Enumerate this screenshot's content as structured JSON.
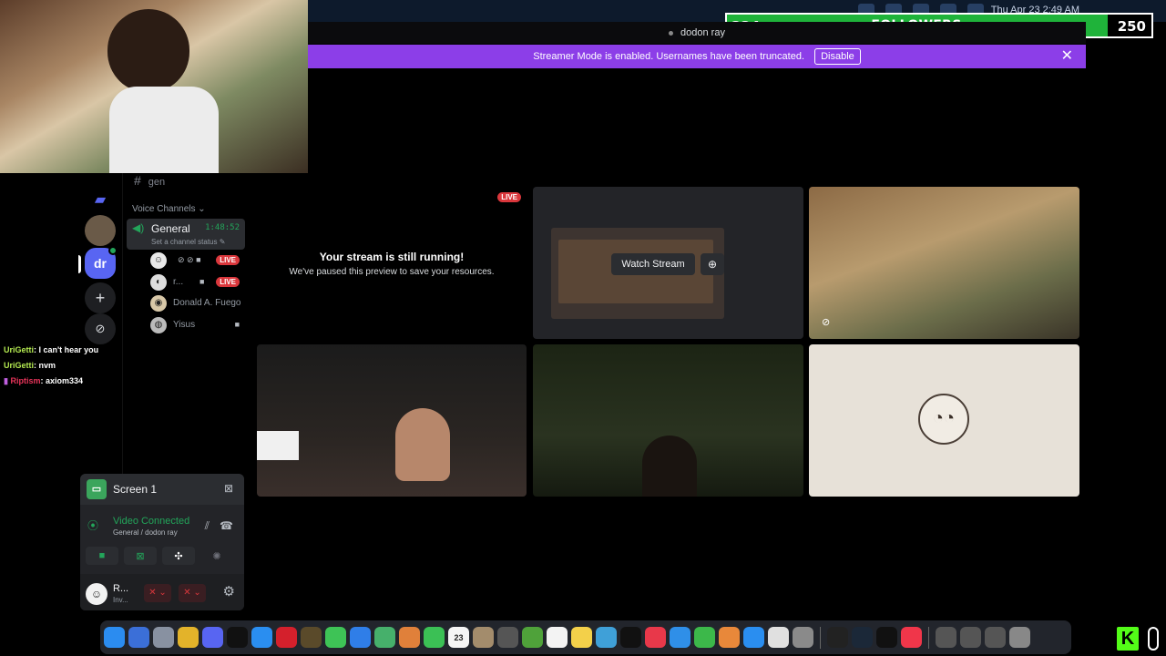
{
  "menubar": {
    "clock": "Thu Apr 23  2:49 AM"
  },
  "followers": {
    "current": "224",
    "label": "FOLLOWERS",
    "goal": "250",
    "progress": 0.896,
    "color": "#1fb33a"
  },
  "window": {
    "title": "dodon ray"
  },
  "streamer_banner": {
    "message": "Streamer Mode is enabled. Usernames have been truncated.",
    "disable_label": "Disable",
    "close": "✕",
    "color": "#8c3ee8"
  },
  "rail": {
    "dr_label": "dr",
    "add": "+",
    "explore": "⊘"
  },
  "channels": {
    "gen": "gen",
    "voice_header": "Voice Channels ⌄",
    "general": {
      "name": "General",
      "timer": "1:48:52",
      "status": "Set a channel status ✎"
    },
    "members": [
      {
        "name": "",
        "live": "LIVE",
        "icons": "⊘ ⊘ ■"
      },
      {
        "name": "r...",
        "live": "LIVE",
        "icons": "■"
      },
      {
        "name": "Donald A. Fuego",
        "live": "",
        "icons": ""
      },
      {
        "name": "Yisus",
        "live": "",
        "icons": "■"
      }
    ]
  },
  "chat": [
    {
      "user": "UriGetti",
      "text": ": I can't hear you",
      "cls": "u1"
    },
    {
      "user": "UriGetti",
      "text": ": nvm",
      "cls": "u1"
    },
    {
      "user": "Riptism",
      "text": ": axiom334",
      "cls": "u2"
    }
  ],
  "panel": {
    "screen": "Screen 1",
    "video_connected": "Video Connected",
    "sub": "General / dodon ray",
    "user_name": "R...",
    "user_status": "Inv..."
  },
  "stage": {
    "live": "LIVE",
    "heading": "Your stream is still running!",
    "sub": "We've paused this preview to save your resources.",
    "watch": "Watch Stream"
  },
  "dock": {
    "apps": [
      {
        "name": "finder",
        "color": "#2b8cf0"
      },
      {
        "name": "launchpad",
        "color": "#3b6fd8"
      },
      {
        "name": "apps",
        "color": "#8891a1"
      },
      {
        "name": "chrome",
        "color": "#e3b32a"
      },
      {
        "name": "discord",
        "color": "#5865f2"
      },
      {
        "name": "tiktok",
        "color": "#111"
      },
      {
        "name": "safari",
        "color": "#2a8ef0"
      },
      {
        "name": "opera",
        "color": "#d4202c"
      },
      {
        "name": "obs",
        "color": "#5a4a2a"
      },
      {
        "name": "messages",
        "color": "#3ec356"
      },
      {
        "name": "mail",
        "color": "#2f7ee8"
      },
      {
        "name": "maps",
        "color": "#46b06b"
      },
      {
        "name": "photos",
        "color": "#e0803a"
      },
      {
        "name": "facetime",
        "color": "#3bc055"
      },
      {
        "name": "calendar",
        "color": "#f5f5f5"
      },
      {
        "name": "contacts",
        "color": "#a38c6c"
      },
      {
        "name": "reminders",
        "color": "#555"
      },
      {
        "name": "minecraft",
        "color": "#4fa23a"
      },
      {
        "name": "notes-list",
        "color": "#f3f3f3"
      },
      {
        "name": "notes",
        "color": "#f3d04a"
      },
      {
        "name": "freeform",
        "color": "#3fa0d8"
      },
      {
        "name": "tv",
        "color": "#111"
      },
      {
        "name": "news",
        "color": "#e8384a"
      },
      {
        "name": "keynote",
        "color": "#2f8fe8"
      },
      {
        "name": "numbers",
        "color": "#3cb84a"
      },
      {
        "name": "pages",
        "color": "#e8883a"
      },
      {
        "name": "app-store",
        "color": "#2a8ef0"
      },
      {
        "name": "roblox",
        "color": "#e0e0e0"
      },
      {
        "name": "settings",
        "color": "#8a8a8a"
      },
      {
        "name": "activity",
        "color": "#222"
      },
      {
        "name": "steam",
        "color": "#1b2838"
      },
      {
        "name": "cursor",
        "color": "#111"
      },
      {
        "name": "music",
        "color": "#f0364a"
      }
    ],
    "calendar_day": "23"
  },
  "kick": {
    "label": "K"
  }
}
